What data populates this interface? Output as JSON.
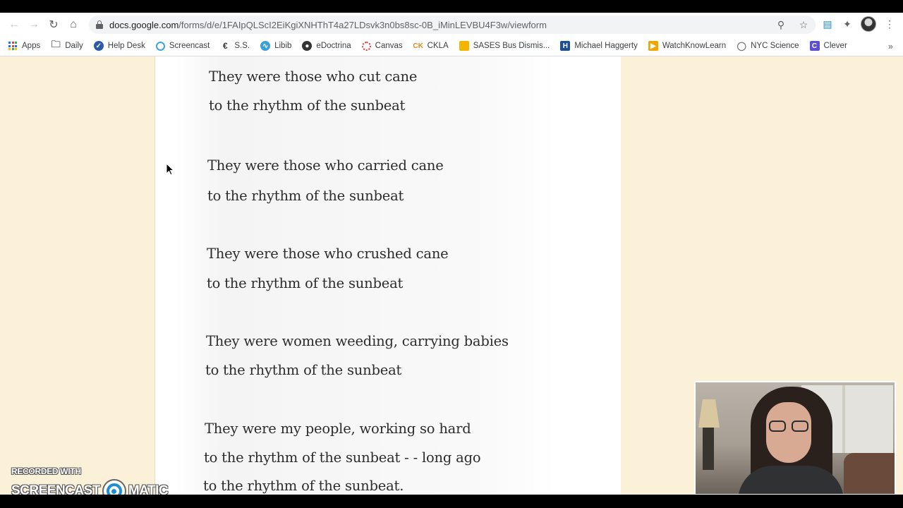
{
  "browser": {
    "url_host": "docs.google.com",
    "url_path": "/forms/d/e/1FAIpQLScI2EiKgiXNHThT4a27LDsvk3n0bs8sc-0B_iMinLEVBU4F3w/viewform",
    "bookmarks": [
      {
        "label": "Apps",
        "icon": "apps-grid-icon"
      },
      {
        "label": "Daily",
        "icon": "folder-icon"
      },
      {
        "label": "Help Desk",
        "icon": "helpdesk-icon"
      },
      {
        "label": "Screencast",
        "icon": "screencast-icon"
      },
      {
        "label": "S.S.",
        "icon": "ss-icon"
      },
      {
        "label": "Libib",
        "icon": "libib-icon"
      },
      {
        "label": "eDoctrina",
        "icon": "globe-icon"
      },
      {
        "label": "Canvas",
        "icon": "canvas-icon"
      },
      {
        "label": "CKLA",
        "icon": "ckla-icon"
      },
      {
        "label": "SASES Bus Dismis...",
        "icon": "sheets-icon"
      },
      {
        "label": "Michael Haggerty",
        "icon": "h-icon"
      },
      {
        "label": "WatchKnowLearn",
        "icon": "play-icon"
      },
      {
        "label": "NYC Science",
        "icon": "bulb-icon"
      },
      {
        "label": "Clever",
        "icon": "clever-icon"
      }
    ],
    "more_bookmarks": "»"
  },
  "poem": {
    "lines": [
      "They were those who cut cane",
      "to the rhythm of the sunbeat",
      "They were those who carried cane",
      "to the rhythm of the sunbeat",
      "They were those who crushed cane",
      "to the rhythm of the sunbeat",
      "They were women weeding, carrying babies",
      "to the rhythm of the sunbeat",
      "They were my people, working so hard",
      "to the rhythm of the sunbeat - - long ago",
      "to the rhythm of the sunbeat."
    ]
  },
  "watermark": {
    "recorded_with": "RECORDED WITH",
    "brand_left": "SCREENCAST",
    "brand_right": "MATIC"
  },
  "colors": {
    "page_bg": "#fbf0d8",
    "card_bg": "#ffffff",
    "text": "#2c2c2c",
    "accent": "#1a73e8"
  }
}
